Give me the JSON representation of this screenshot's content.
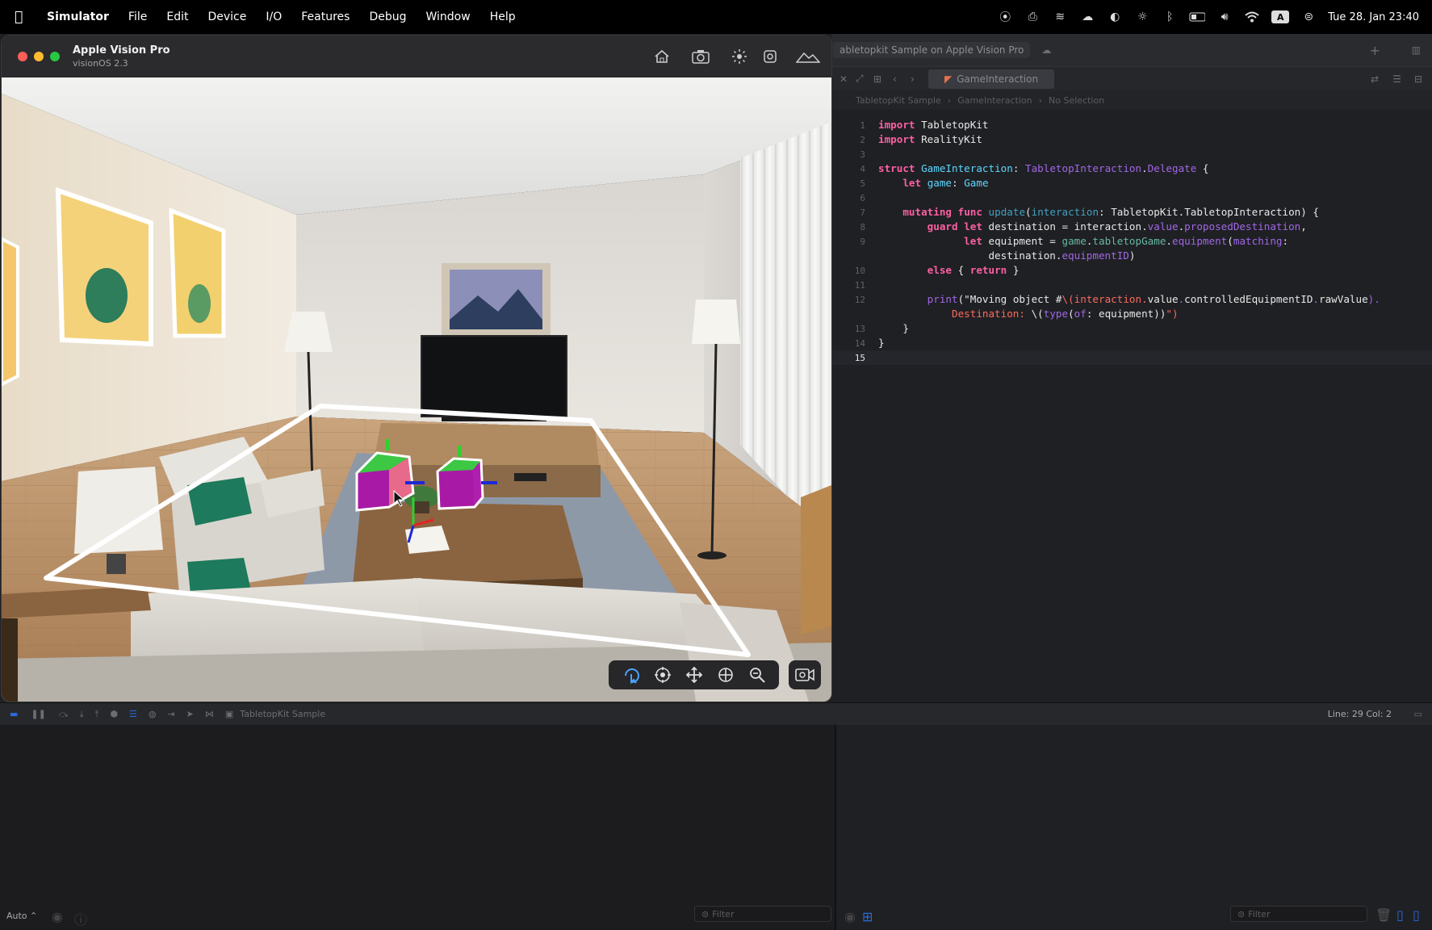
{
  "menubar": {
    "app": "Simulator",
    "items": [
      "File",
      "Edit",
      "Device",
      "I/O",
      "Features",
      "Debug",
      "Window",
      "Help"
    ],
    "input_badge": "A",
    "clock": "Tue 28. Jan  23:40"
  },
  "simulator": {
    "device_name": "Apple Vision Pro",
    "os_version": "visionOS 2.3"
  },
  "xcode": {
    "window_title": "abletopkit Sample on Apple Vision Pro",
    "active_tab": "GameInteraction",
    "breadcrumb": [
      "TabletopKit Sample",
      "GameInteraction",
      "No Selection"
    ],
    "status_scheme": "TabletopKit Sample",
    "cursor_position": "Line: 29  Col: 2",
    "filter_placeholder": "Filter",
    "auto_label": "Auto ⌃",
    "code_lines": [
      {
        "n": "1"
      },
      {
        "n": "2"
      },
      {
        "n": "3"
      },
      {
        "n": "4"
      },
      {
        "n": "5"
      },
      {
        "n": "6"
      },
      {
        "n": "7"
      },
      {
        "n": "8"
      },
      {
        "n": "9"
      },
      {
        "n": "10"
      },
      {
        "n": "11"
      },
      {
        "n": "12"
      },
      {
        "n": "13"
      },
      {
        "n": "14"
      },
      {
        "n": "15"
      }
    ],
    "code": {
      "l1": [
        "import",
        " TabletopKit"
      ],
      "l2": [
        "import",
        " RealityKit"
      ],
      "l4": [
        "struct",
        " ",
        "GameInteraction",
        ": ",
        "TabletopInteraction",
        ".",
        "Delegate",
        " {"
      ],
      "l5": [
        "    ",
        "let",
        " ",
        "game",
        ": ",
        "Game"
      ],
      "l7": [
        "    ",
        "mutating",
        " ",
        "func",
        " ",
        "update",
        "(",
        "interaction",
        ": TabletopKit.TabletopInteraction) {"
      ],
      "l8": [
        "        ",
        "guard",
        " ",
        "let",
        " destination = interaction.",
        "value",
        ".",
        "proposedDestination",
        ","
      ],
      "l9": [
        "              ",
        "let",
        " equipment = ",
        "game",
        ".",
        "tabletopGame",
        ".",
        "equipment",
        "(",
        "matching",
        ":"
      ],
      "l9b": [
        "                  destination.",
        "equipmentID",
        ")"
      ],
      "l10": [
        "        ",
        "else",
        " { ",
        "return",
        " }"
      ],
      "l12": [
        "        ",
        "print",
        "(\"Moving object #",
        "\\(interaction.",
        "value",
        ".",
        "controlledEquipmentID",
        ".",
        "rawValue",
        ")."
      ],
      "l12b": [
        "            Destination: ",
        "\\(",
        "type",
        "(",
        "of",
        ": equipment))",
        "\")"
      ],
      "l13": [
        "    }"
      ],
      "l14": [
        "}"
      ]
    }
  }
}
